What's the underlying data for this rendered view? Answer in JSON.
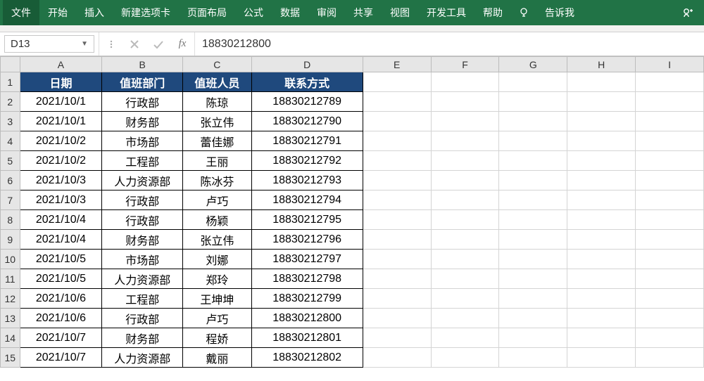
{
  "ribbon": {
    "tabs": [
      "文件",
      "开始",
      "插入",
      "新建选项卡",
      "页面布局",
      "公式",
      "数据",
      "审阅",
      "共享",
      "视图",
      "开发工具",
      "帮助"
    ],
    "tell_me": "告诉我"
  },
  "formula_bar": {
    "name_box": "D13",
    "value": "18830212800"
  },
  "columns": [
    "A",
    "B",
    "C",
    "D",
    "E",
    "F",
    "G",
    "H",
    "I"
  ],
  "headers": [
    "日期",
    "值班部门",
    "值班人员",
    "联系方式"
  ],
  "rows": [
    {
      "n": 1
    },
    {
      "n": 2,
      "c": [
        "2021/10/1",
        "行政部",
        "陈琼",
        "18830212789"
      ]
    },
    {
      "n": 3,
      "c": [
        "2021/10/1",
        "财务部",
        "张立伟",
        "18830212790"
      ]
    },
    {
      "n": 4,
      "c": [
        "2021/10/2",
        "市场部",
        "蕾佳娜",
        "18830212791"
      ]
    },
    {
      "n": 5,
      "c": [
        "2021/10/2",
        "工程部",
        "王丽",
        "18830212792"
      ]
    },
    {
      "n": 6,
      "c": [
        "2021/10/3",
        "人力资源部",
        "陈冰芬",
        "18830212793"
      ]
    },
    {
      "n": 7,
      "c": [
        "2021/10/3",
        "行政部",
        "卢巧",
        "18830212794"
      ]
    },
    {
      "n": 8,
      "c": [
        "2021/10/4",
        "行政部",
        "杨颖",
        "18830212795"
      ]
    },
    {
      "n": 9,
      "c": [
        "2021/10/4",
        "财务部",
        "张立伟",
        "18830212796"
      ]
    },
    {
      "n": 10,
      "c": [
        "2021/10/5",
        "市场部",
        "刘娜",
        "18830212797"
      ]
    },
    {
      "n": 11,
      "c": [
        "2021/10/5",
        "人力资源部",
        "郑玲",
        "18830212798"
      ]
    },
    {
      "n": 12,
      "c": [
        "2021/10/6",
        "工程部",
        "王坤坤",
        "18830212799"
      ]
    },
    {
      "n": 13,
      "c": [
        "2021/10/6",
        "行政部",
        "卢巧",
        "18830212800"
      ]
    },
    {
      "n": 14,
      "c": [
        "2021/10/7",
        "财务部",
        "程娇",
        "18830212801"
      ]
    },
    {
      "n": 15,
      "c": [
        "2021/10/7",
        "人力资源部",
        "戴丽",
        "18830212802"
      ]
    }
  ]
}
